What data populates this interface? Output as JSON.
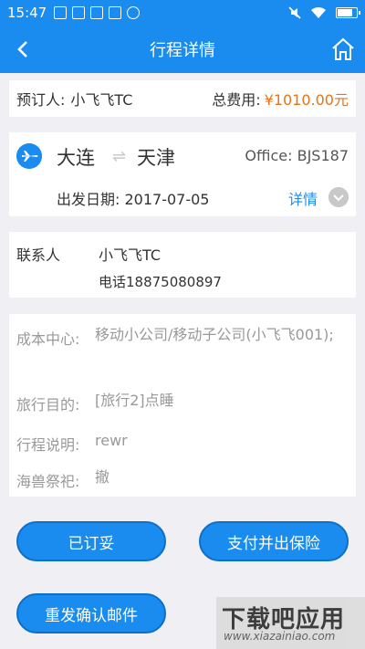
{
  "status_bar": {
    "time": "15:47"
  },
  "nav": {
    "title": "行程详情"
  },
  "booking": {
    "booker_label": "预订人:",
    "booker_name": "小飞飞TC",
    "total_label": "总费用:",
    "total_amount": "¥1010.00元"
  },
  "flight": {
    "from_city": "大连",
    "to_city": "天津",
    "office": "Office: BJS187",
    "departure_label": "出发日期:",
    "departure_date": "2017-07-05",
    "detail_link": "详情"
  },
  "contact": {
    "label": "联系人",
    "name": "小飞飞TC",
    "phone": "电话18875080897"
  },
  "info": [
    {
      "key": "成本中心:",
      "value": "移动小公司/移动子公司(小飞飞001);"
    },
    {
      "key": "旅行目的:",
      "value": "[旅行2]点睡"
    },
    {
      "key": "行程说明:",
      "value": "rewr"
    },
    {
      "key": "海兽祭祀:",
      "value": "撤"
    }
  ],
  "buttons": {
    "booked": "已订妥",
    "pay_insure": "支付并出保险",
    "resend": "重发确认邮件"
  },
  "watermark": {
    "title": "下载吧应用",
    "url": "www.xiazainiao.com"
  },
  "colors": {
    "primary": "#1a8cf0",
    "price": "#e8731a",
    "muted": "#999999"
  }
}
